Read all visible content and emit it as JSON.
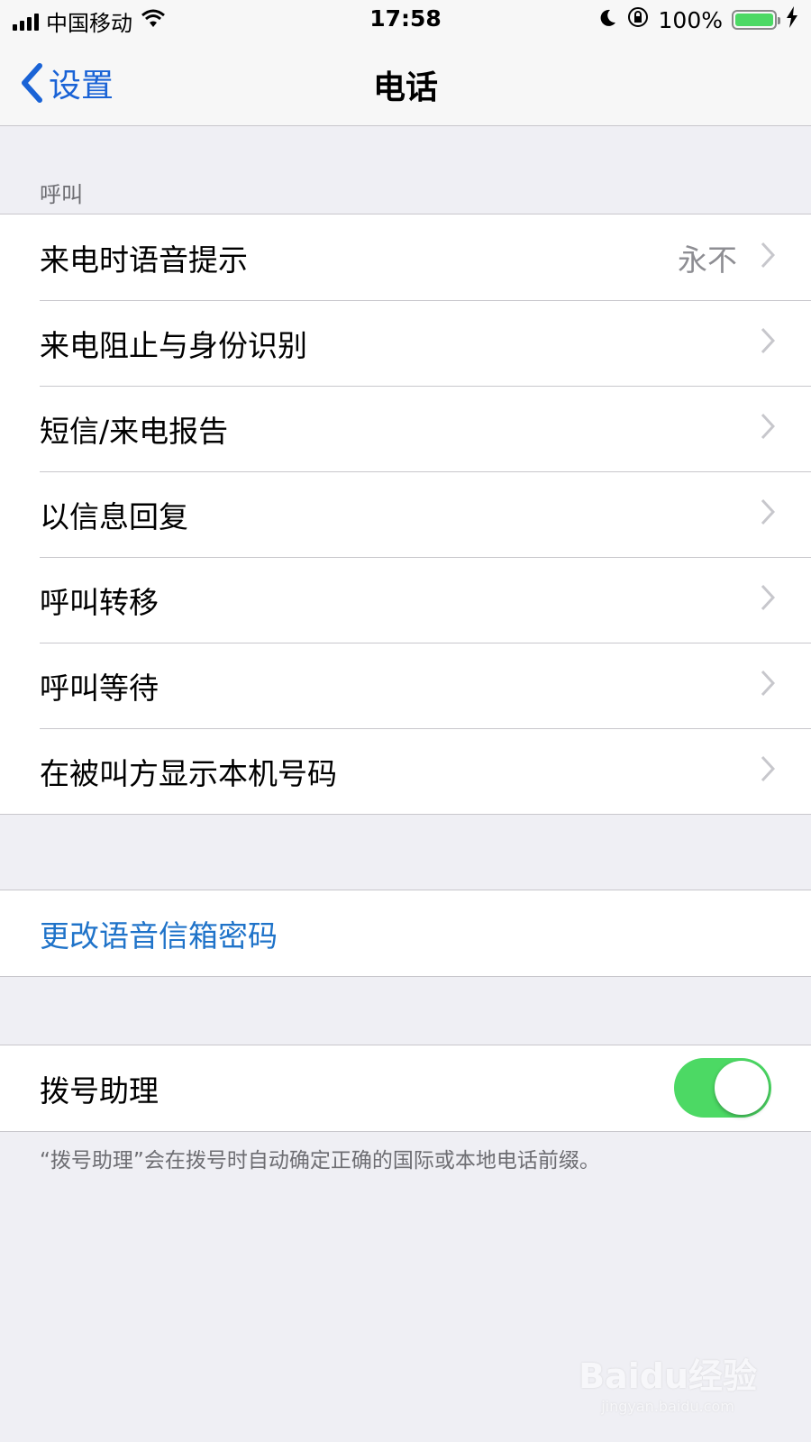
{
  "status_bar": {
    "carrier": "中国移动",
    "time": "17:58",
    "battery_percent": "100%",
    "battery_level": 1.0
  },
  "nav": {
    "back_label": "设置",
    "title": "电话"
  },
  "calling": {
    "header": "呼叫",
    "items": [
      {
        "label": "来电时语音提示",
        "value": "永不"
      },
      {
        "label": "来电阻止与身份识别"
      },
      {
        "label": "短信/来电报告"
      },
      {
        "label": "以信息回复"
      },
      {
        "label": "呼叫转移"
      },
      {
        "label": "呼叫等待"
      },
      {
        "label": "在被叫方显示本机号码"
      }
    ]
  },
  "voicemail": {
    "change_password_label": "更改语音信箱密码"
  },
  "dial_assist": {
    "label": "拨号助理",
    "enabled": true,
    "footer": "“拨号助理”会在拨号时自动确定正确的国际或本地电话前缀。"
  },
  "watermark": {
    "main": "Baidu经验",
    "sub": "jingyan.baidu.com"
  },
  "colors": {
    "accent": "#1a63d6",
    "toggle_on": "#4cd964",
    "background": "#efeff4"
  }
}
